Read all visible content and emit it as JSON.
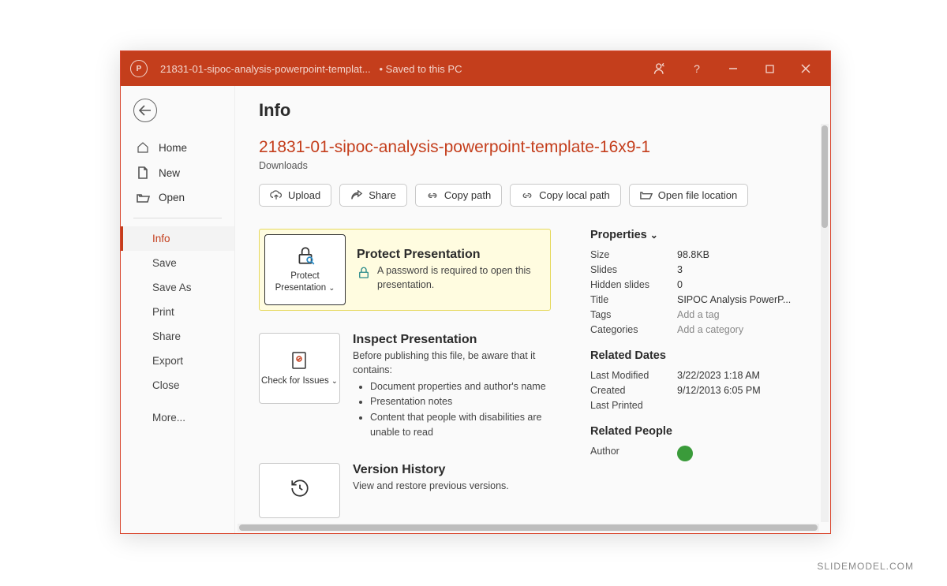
{
  "titlebar": {
    "filename_short": "21831-01-sipoc-analysis-powerpoint-templat...",
    "save_status": "• Saved to this PC"
  },
  "sidebar": {
    "back": "Back",
    "main": [
      {
        "icon": "home",
        "label": "Home"
      },
      {
        "icon": "new",
        "label": "New"
      },
      {
        "icon": "open",
        "label": "Open"
      }
    ],
    "sub": [
      {
        "label": "Info",
        "active": true
      },
      {
        "label": "Save"
      },
      {
        "label": "Save As"
      },
      {
        "label": "Print"
      },
      {
        "label": "Share"
      },
      {
        "label": "Export"
      },
      {
        "label": "Close"
      },
      {
        "label": "More..."
      }
    ]
  },
  "info": {
    "heading": "Info",
    "filename": "21831-01-sipoc-analysis-powerpoint-template-16x9-1",
    "location": "Downloads",
    "actions": {
      "upload": "Upload",
      "share": "Share",
      "copy_path": "Copy path",
      "copy_local_path": "Copy local path",
      "open_file_location": "Open file location"
    },
    "protect": {
      "btn": "Protect Presentation",
      "title": "Protect Presentation",
      "desc": "A password is required to open this presentation."
    },
    "inspect": {
      "btn": "Check for Issues",
      "title": "Inspect Presentation",
      "desc": "Before publishing this file, be aware that it contains:",
      "items": [
        "Document properties and author's name",
        "Presentation notes",
        "Content that people with disabilities are unable to read"
      ]
    },
    "history": {
      "title": "Version History",
      "desc": "View and restore previous versions."
    }
  },
  "properties": {
    "heading": "Properties",
    "rows": [
      {
        "k": "Size",
        "v": "98.8KB"
      },
      {
        "k": "Slides",
        "v": "3"
      },
      {
        "k": "Hidden slides",
        "v": "0"
      },
      {
        "k": "Title",
        "v": "SIPOC Analysis PowerP..."
      },
      {
        "k": "Tags",
        "v": "Add a tag",
        "muted": true
      },
      {
        "k": "Categories",
        "v": "Add a category",
        "muted": true
      }
    ]
  },
  "dates": {
    "heading": "Related Dates",
    "rows": [
      {
        "k": "Last Modified",
        "v": "3/22/2023 1:18 AM"
      },
      {
        "k": "Created",
        "v": "9/12/2013 6:05 PM"
      },
      {
        "k": "Last Printed",
        "v": ""
      }
    ]
  },
  "people": {
    "heading": "Related People",
    "author_label": "Author"
  },
  "watermark": "SLIDEMODEL.COM"
}
